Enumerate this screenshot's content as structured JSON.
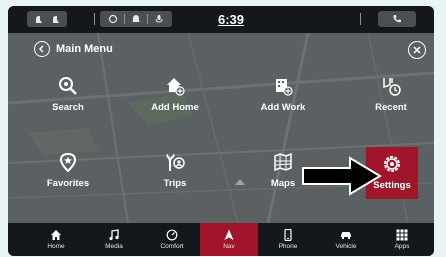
{
  "statusbar": {
    "clock": "6:39",
    "icons": [
      "seat-heat-icon",
      "seat-vent-icon",
      "heated-wheel-icon",
      "notification-icon",
      "microphone-icon",
      "phone-icon"
    ]
  },
  "header": {
    "title": "Main Menu",
    "back_icon": "chevron-left-icon",
    "close_icon": "close-icon"
  },
  "menu": {
    "items": [
      {
        "label": "Search",
        "icon": "search-icon"
      },
      {
        "label": "Add Home",
        "icon": "add-home-icon"
      },
      {
        "label": "Add Work",
        "icon": "add-work-icon"
      },
      {
        "label": "Recent",
        "icon": "recent-icon"
      },
      {
        "label": "Favorites",
        "icon": "favorites-icon"
      },
      {
        "label": "Trips",
        "icon": "trips-icon"
      },
      {
        "label": "Maps",
        "icon": "maps-icon"
      },
      {
        "label": "Settings",
        "icon": "gear-icon",
        "active": true
      }
    ]
  },
  "navbar": {
    "items": [
      {
        "label": "Home",
        "icon": "home-icon"
      },
      {
        "label": "Media",
        "icon": "music-note-icon"
      },
      {
        "label": "Comfort",
        "icon": "gauge-icon"
      },
      {
        "label": "Nav",
        "icon": "navigation-arrow-icon",
        "active": true
      },
      {
        "label": "Phone",
        "icon": "phone-icon"
      },
      {
        "label": "Vehicle",
        "icon": "car-icon"
      },
      {
        "label": "Apps",
        "icon": "grid-icon"
      }
    ]
  },
  "colors": {
    "accent": "#a0152a",
    "bar_bg": "#15181b",
    "main_bg": "#5a5f62"
  }
}
